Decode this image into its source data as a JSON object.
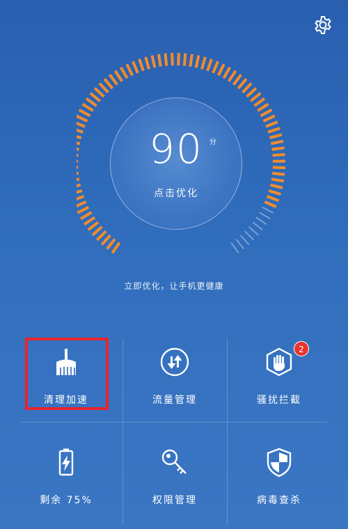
{
  "header": {
    "settings_icon": "gear-icon"
  },
  "gauge": {
    "score": "90",
    "score_unit": "分",
    "action_label": "点击优化",
    "level": 0.9,
    "colors": {
      "active": "#f28c2c",
      "inactive": "#a9c4e6"
    }
  },
  "tagline": "立即优化，让手机更健康",
  "tiles": [
    {
      "label": "清理加速",
      "icon": "broom-icon"
    },
    {
      "label": "流量管理",
      "icon": "data-transfer-icon"
    },
    {
      "label": "骚扰拦截",
      "icon": "hand-block-icon",
      "badge": "2"
    },
    {
      "label": "剩余 75%",
      "icon": "battery-icon"
    },
    {
      "label": "权限管理",
      "icon": "key-icon"
    },
    {
      "label": "病毒查杀",
      "icon": "shield-icon"
    }
  ],
  "highlight": {
    "target": "清理加速",
    "color": "#e8242a"
  }
}
